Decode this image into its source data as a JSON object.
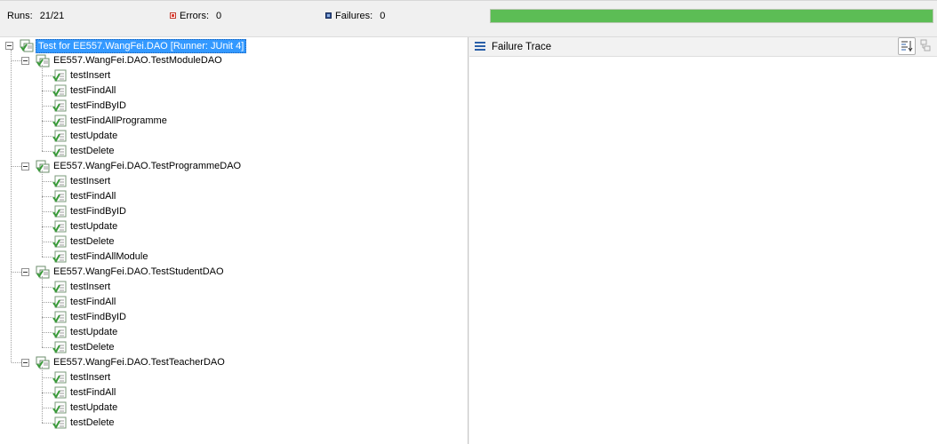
{
  "status": {
    "runs_label": "Runs:",
    "runs_value": "21/21",
    "errors_label": "Errors:",
    "errors_value": "0",
    "failures_label": "Failures:",
    "failures_value": "0",
    "progress_fraction": 1.0,
    "progress_color": "#5cbd55"
  },
  "tree": {
    "root_label": "Test for EE557.WangFei.DAO [Runner: JUnit 4]",
    "suites": [
      {
        "label": "EE557.WangFei.DAO.TestModuleDAO",
        "tests": [
          "testInsert",
          "testFindAll",
          "testFindByID",
          "testFindAllProgramme",
          "testUpdate",
          "testDelete"
        ]
      },
      {
        "label": "EE557.WangFei.DAO.TestProgrammeDAO",
        "tests": [
          "testInsert",
          "testFindAll",
          "testFindByID",
          "testUpdate",
          "testDelete",
          "testFindAllModule"
        ]
      },
      {
        "label": "EE557.WangFei.DAO.TestStudentDAO",
        "tests": [
          "testInsert",
          "testFindAll",
          "testFindByID",
          "testUpdate",
          "testDelete"
        ]
      },
      {
        "label": "EE557.WangFei.DAO.TestTeacherDAO",
        "tests": [
          "testInsert",
          "testFindAll",
          "testUpdate",
          "testDelete"
        ]
      }
    ]
  },
  "trace": {
    "title": "Failure Trace",
    "icons": [
      "list-icon",
      "filter-stack-icon",
      "compare-icon"
    ]
  },
  "colors": {
    "selection": "#3399ff",
    "pass": "#3a9a3a",
    "accent": "#2a5fa8"
  }
}
